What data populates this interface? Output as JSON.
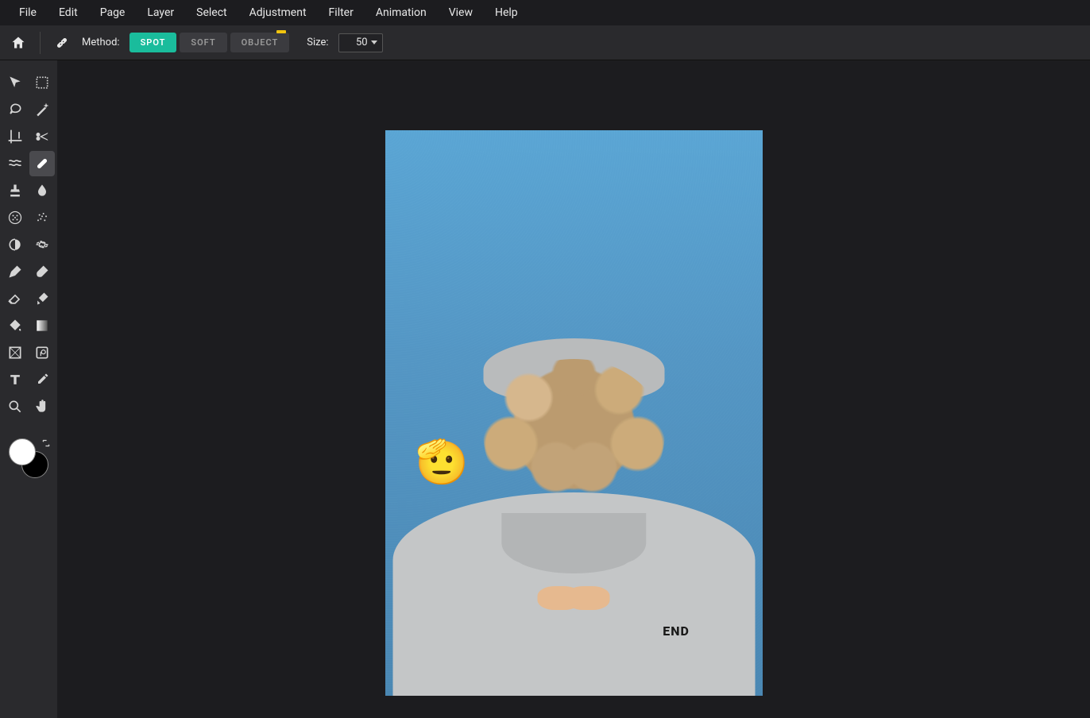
{
  "menu": {
    "items": [
      "File",
      "Edit",
      "Page",
      "Layer",
      "Select",
      "Adjustment",
      "Filter",
      "Animation",
      "View",
      "Help"
    ]
  },
  "options": {
    "method_label": "Method:",
    "methods": [
      {
        "label": "SPOT",
        "active": true,
        "badge": false
      },
      {
        "label": "SOFT",
        "active": false,
        "badge": false
      },
      {
        "label": "OBJECT",
        "active": false,
        "badge": true
      }
    ],
    "size_label": "Size:",
    "size_value": "50"
  },
  "tools": {
    "items": [
      {
        "name": "arrow-tool",
        "icon": "arrow"
      },
      {
        "name": "marquee-tool",
        "icon": "marquee"
      },
      {
        "name": "lasso-tool",
        "icon": "lasso"
      },
      {
        "name": "wand-tool",
        "icon": "wand"
      },
      {
        "name": "crop-tool",
        "icon": "crop"
      },
      {
        "name": "cutout-tool",
        "icon": "scissors"
      },
      {
        "name": "liquify-tool",
        "icon": "liquify"
      },
      {
        "name": "heal-tool",
        "icon": "bandaid",
        "active": true
      },
      {
        "name": "clone-tool",
        "icon": "stamp"
      },
      {
        "name": "blur-tool",
        "icon": "drop"
      },
      {
        "name": "disperse-tool",
        "icon": "dots-circle"
      },
      {
        "name": "spray-tool",
        "icon": "spray"
      },
      {
        "name": "dodge-tool",
        "icon": "dodge"
      },
      {
        "name": "sharpen-tool",
        "icon": "gear"
      },
      {
        "name": "pen-tool",
        "icon": "pen"
      },
      {
        "name": "brush-tool",
        "icon": "brush"
      },
      {
        "name": "eraser-tool",
        "icon": "eraser"
      },
      {
        "name": "replace-color-tool",
        "icon": "brush2"
      },
      {
        "name": "fill-tool",
        "icon": "bucket"
      },
      {
        "name": "gradient-tool",
        "icon": "gradient"
      },
      {
        "name": "shape-tool",
        "icon": "shape"
      },
      {
        "name": "frame-tool",
        "icon": "frame"
      },
      {
        "name": "text-tool",
        "icon": "text"
      },
      {
        "name": "picker-tool",
        "icon": "dropper"
      },
      {
        "name": "zoom-tool",
        "icon": "zoom"
      },
      {
        "name": "hand-tool",
        "icon": "hand"
      }
    ],
    "foreground_color": "#ffffff",
    "background_color": "#000000"
  },
  "canvas": {
    "emoji": "🫡",
    "hoodie_text": "END"
  }
}
